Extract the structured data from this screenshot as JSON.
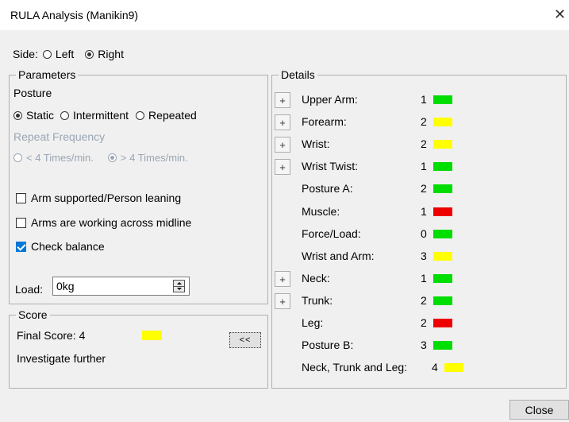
{
  "window": {
    "title": "RULA Analysis (Manikin9)",
    "close_glyph": "✕"
  },
  "side": {
    "label": "Side:",
    "options": [
      "Left",
      "Right"
    ],
    "selected": "Right"
  },
  "parameters": {
    "group_title": "Parameters",
    "posture_label": "Posture",
    "posture_options": [
      "Static",
      "Intermittent",
      "Repeated"
    ],
    "posture_selected": "Static",
    "repeat_frequency_label": "Repeat Frequency",
    "repeat_options": [
      "< 4 Times/min.",
      "> 4 Times/min."
    ],
    "repeat_selected": "> 4 Times/min.",
    "checkboxes": [
      {
        "label": "Arm supported/Person leaning",
        "checked": false
      },
      {
        "label": "Arms are working across midline",
        "checked": false
      },
      {
        "label": "Check balance",
        "checked": true
      }
    ],
    "load_label": "Load:",
    "load_value": "0kg"
  },
  "score": {
    "group_title": "Score",
    "final_score_text": "Final Score: 4",
    "final_color": "#ffff00",
    "recommendation": "Investigate further",
    "collapse_label": "<<"
  },
  "details": {
    "group_title": "Details",
    "rows": [
      {
        "label": "Upper Arm:",
        "score": "1",
        "color": "#00dd00",
        "expandable": true
      },
      {
        "label": "Forearm:",
        "score": "2",
        "color": "#ffff00",
        "expandable": true
      },
      {
        "label": "Wrist:",
        "score": "2",
        "color": "#ffff00",
        "expandable": true
      },
      {
        "label": "Wrist Twist:",
        "score": "1",
        "color": "#00dd00",
        "expandable": true
      },
      {
        "label": "Posture A:",
        "score": "2",
        "color": "#00dd00",
        "expandable": false
      },
      {
        "label": "Muscle:",
        "score": "1",
        "color": "#ee0000",
        "expandable": false
      },
      {
        "label": "Force/Load:",
        "score": "0",
        "color": "#00dd00",
        "expandable": false
      },
      {
        "label": "Wrist and Arm:",
        "score": "3",
        "color": "#ffff00",
        "expandable": false
      },
      {
        "label": "Neck:",
        "score": "1",
        "color": "#00dd00",
        "expandable": true
      },
      {
        "label": "Trunk:",
        "score": "2",
        "color": "#00dd00",
        "expandable": true
      },
      {
        "label": "Leg:",
        "score": "2",
        "color": "#ee0000",
        "expandable": false
      },
      {
        "label": "Posture B:",
        "score": "3",
        "color": "#00dd00",
        "expandable": false
      },
      {
        "label": "Neck, Trunk and Leg:",
        "score": "4",
        "color": "#ffff00",
        "expandable": false
      }
    ],
    "plus_glyph": "+"
  },
  "footer": {
    "close_label": "Close"
  }
}
